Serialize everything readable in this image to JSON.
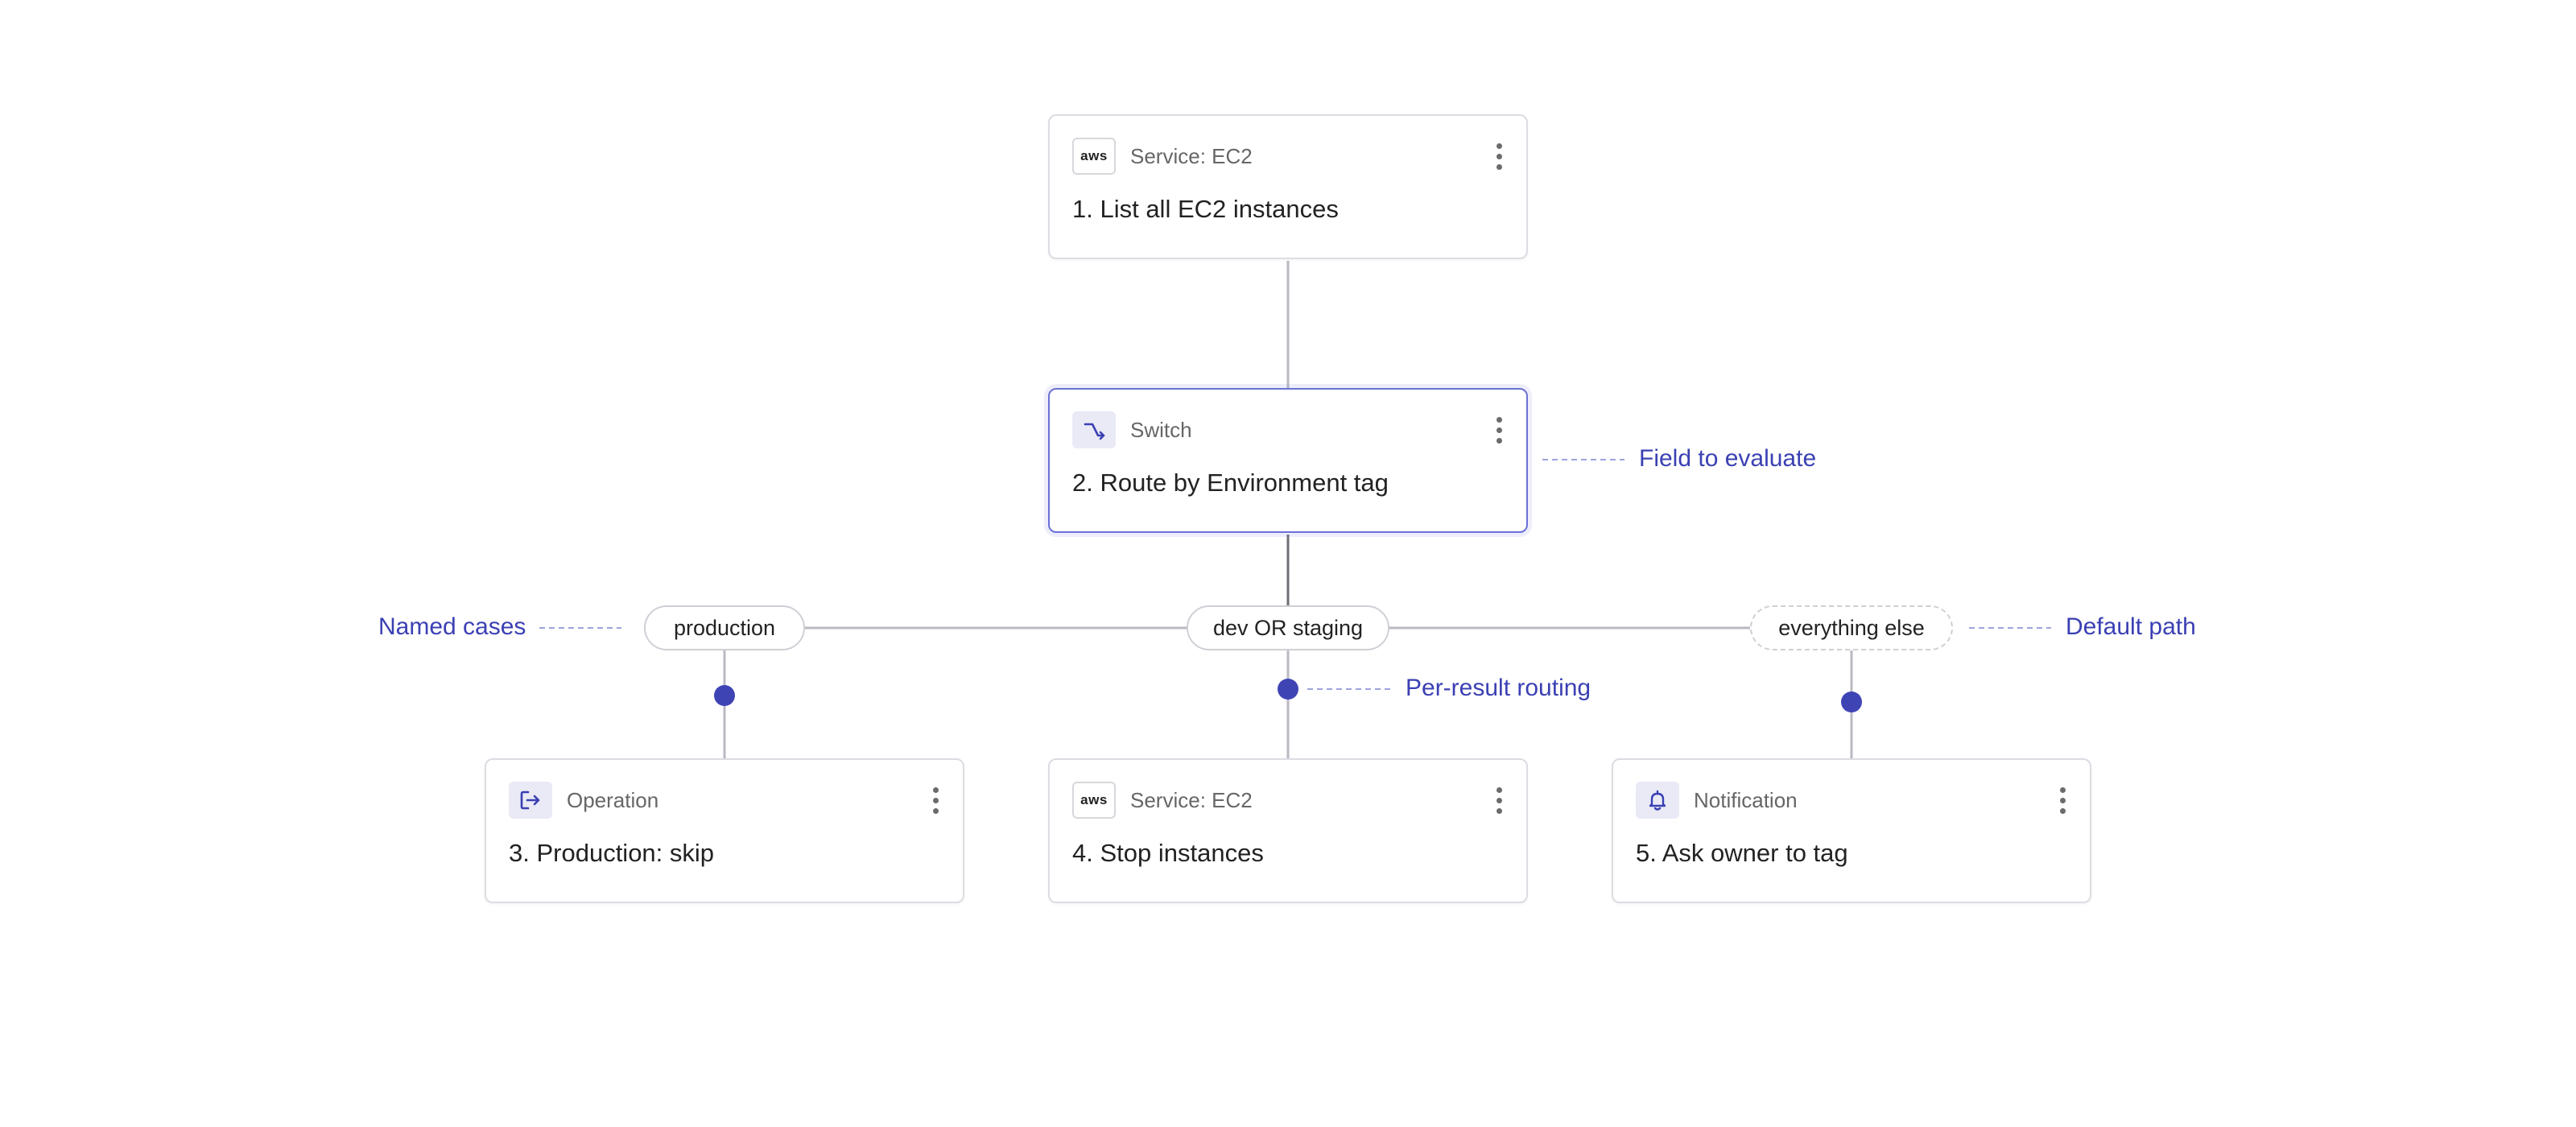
{
  "nodes": [
    {
      "type_label": "Service: EC2",
      "icon": "aws-logo-icon",
      "icon_text": "aws",
      "title": "1. List all EC2 instances"
    },
    {
      "type_label": "Switch",
      "icon": "switch-route-icon",
      "title": "2. Route by Environment tag"
    },
    {
      "type_label": "Operation",
      "icon": "exit-arrow-icon",
      "title": "3. Production: skip"
    },
    {
      "type_label": "Service: EC2",
      "icon": "aws-logo-icon",
      "icon_text": "aws",
      "title": "4. Stop instances"
    },
    {
      "type_label": "Notification",
      "icon": "bell-icon",
      "title": "5. Ask owner to tag"
    }
  ],
  "cases": [
    {
      "label": "production"
    },
    {
      "label": "dev OR staging"
    },
    {
      "label": "everything else",
      "style": "dashed"
    }
  ],
  "annotations": {
    "field_to_evaluate": "Field to evaluate",
    "named_cases": "Named cases",
    "per_result_routing": "Per-result routing",
    "default_path": "Default path"
  },
  "colors": {
    "accent": "#3b40b3",
    "connector": "#b9bac2",
    "branch_dot": "#3f44b5",
    "card_border": "#dcdde3",
    "selected_border": "#6b70d6"
  }
}
